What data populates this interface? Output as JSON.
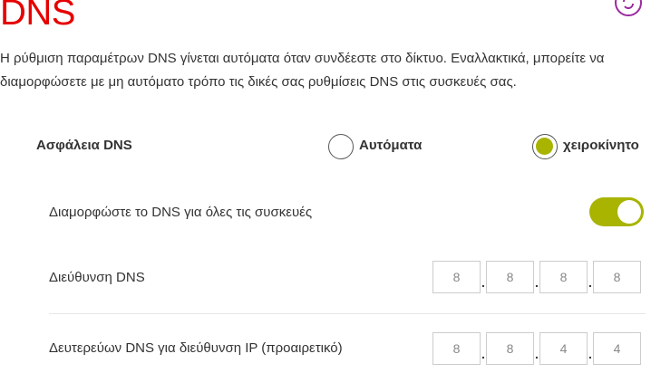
{
  "header": {
    "title": "DNS",
    "refresh_icon": "refresh-icon"
  },
  "description": "Η ρύθμιση παραμέτρων DNS γίνεται αυτόματα όταν συνδέεστε στο δίκτυο. Εναλλακτικά, μπορείτε να διαμορφώσετε με μη αυτόματο τρόπο τις δικές σας ρυθμίσεις DNS στις συσκευές σας.",
  "dns_security": {
    "label": "Ασφάλεια DNS",
    "options": [
      {
        "label": "Αυτόματα",
        "selected": false
      },
      {
        "label": "χειροκίνητο",
        "selected": true
      }
    ]
  },
  "configure_all": {
    "label": "Διαμορφώστε το DNS για όλες τις συσκευές",
    "enabled": true
  },
  "dns_address": {
    "label": "Διεύθυνση DNS",
    "octets": [
      "8",
      "8",
      "8",
      "8"
    ]
  },
  "secondary_dns": {
    "label": "Δευτερεύων DNS για διεύθυνση IP (προαιρετικό)",
    "octets": [
      "8",
      "8",
      "4",
      "4"
    ]
  },
  "colors": {
    "title": "#e60000",
    "accent": "#a8b400",
    "refresh": "#9c2aa0"
  }
}
